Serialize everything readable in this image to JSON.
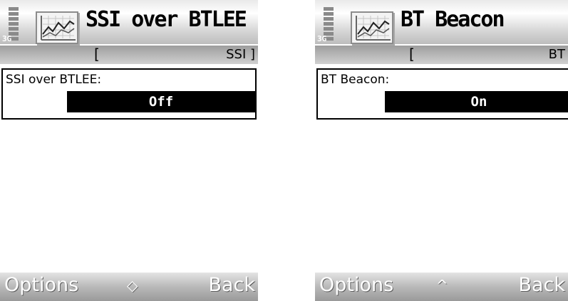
{
  "screens": [
    {
      "network": "3G",
      "title": "SSI over BTLEE",
      "navi_bracket": "[",
      "navi_tab": "SSI ]",
      "setting_label": "SSI over BTLEE:",
      "setting_value": "Off",
      "softkey_left": "Options",
      "scroll_indicator": "◇",
      "softkey_right": "Back",
      "icon": "graph-app-icon"
    },
    {
      "network": "3G",
      "title": "BT Beacon",
      "navi_bracket": "[",
      "navi_tab": "BT",
      "setting_label": "BT Beacon:",
      "setting_value": "On",
      "softkey_left": "Options",
      "scroll_indicator": "^",
      "softkey_right": "Back",
      "icon": "graph-app-icon"
    }
  ]
}
